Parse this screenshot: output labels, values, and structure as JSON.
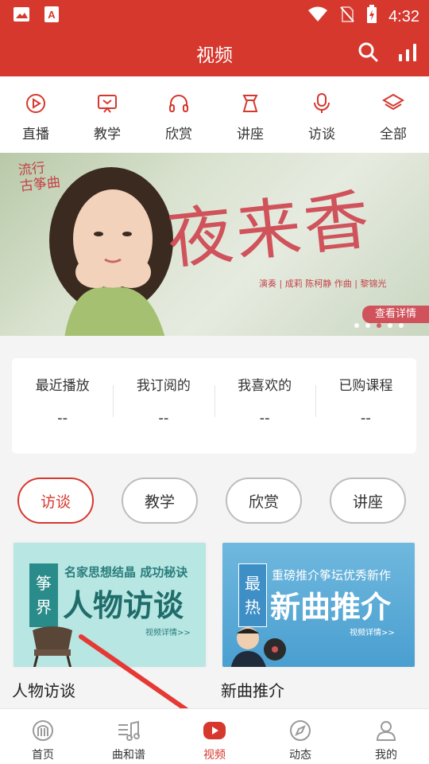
{
  "status_bar": {
    "time": "4:32"
  },
  "app_bar": {
    "title": "视频"
  },
  "categories": [
    {
      "label": "直播",
      "icon": "live-icon"
    },
    {
      "label": "教学",
      "icon": "teaching-icon"
    },
    {
      "label": "欣赏",
      "icon": "headphones-icon"
    },
    {
      "label": "讲座",
      "icon": "lecture-icon"
    },
    {
      "label": "访谈",
      "icon": "microphone-icon"
    },
    {
      "label": "全部",
      "icon": "layers-icon"
    }
  ],
  "banner": {
    "tag_line1": "流行",
    "tag_line2": "古筝曲",
    "title": "夜来香",
    "credits": "演奏 | 成莉 陈柯静   作曲 | 黎锦光",
    "detail_button": "查看详情",
    "slide_count": 5,
    "active_slide": 2
  },
  "stats": [
    {
      "label": "最近播放",
      "value": "--"
    },
    {
      "label": "我订阅的",
      "value": "--"
    },
    {
      "label": "我喜欢的",
      "value": "--"
    },
    {
      "label": "已购课程",
      "value": "--"
    }
  ],
  "filters": [
    {
      "label": "访谈",
      "active": true
    },
    {
      "label": "教学",
      "active": false
    },
    {
      "label": "欣赏",
      "active": false
    },
    {
      "label": "讲座",
      "active": false
    }
  ],
  "cards": [
    {
      "title": "人物访谈",
      "badge": [
        "筝",
        "界"
      ],
      "subtitle": "名家思想结晶 成功秘诀",
      "headline": "人物访谈",
      "more": "视频详情>>"
    },
    {
      "title": "新曲推介",
      "badge": [
        "最",
        "热"
      ],
      "subtitle": "重磅推介筝坛优秀新作",
      "headline": "新曲推介",
      "more": "视频详情>>"
    }
  ],
  "tabbar": [
    {
      "label": "首页",
      "icon": "home-icon"
    },
    {
      "label": "曲和谱",
      "icon": "sheet-music-icon"
    },
    {
      "label": "视频",
      "icon": "video-play-icon",
      "active": true
    },
    {
      "label": "动态",
      "icon": "compass-icon"
    },
    {
      "label": "我的",
      "icon": "profile-icon"
    }
  ],
  "colors": {
    "brand": "#d6382e",
    "accent_pink": "#d0525b"
  }
}
